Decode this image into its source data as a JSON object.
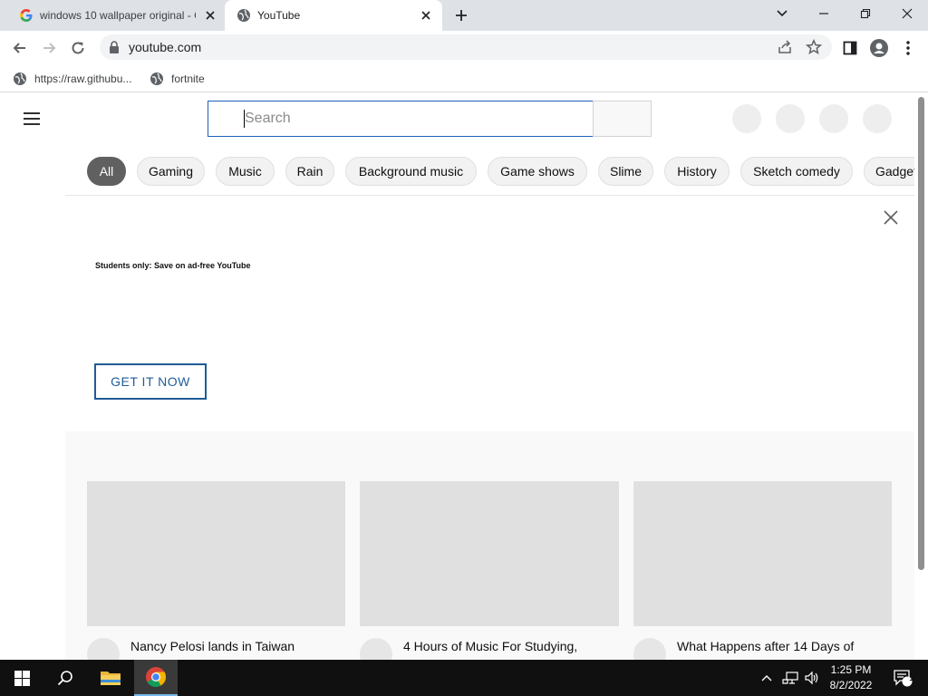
{
  "browser": {
    "tabs": [
      {
        "title": "windows 10 wallpaper original - G",
        "active": false
      },
      {
        "title": "YouTube",
        "active": true
      }
    ],
    "address": "youtube.com",
    "bookmarks": [
      {
        "label": "https://raw.githubu..."
      },
      {
        "label": "fortnite"
      }
    ]
  },
  "youtube": {
    "search_placeholder": "Search",
    "chips": [
      "All",
      "Gaming",
      "Music",
      "Rain",
      "Background music",
      "Game shows",
      "Slime",
      "History",
      "Sketch comedy",
      "Gadgets"
    ],
    "ad": {
      "heading": "Students only: Save on ad-free YouTube",
      "cta": "GET IT NOW"
    },
    "videos": [
      {
        "title": "Nancy Pelosi lands in Taiwan"
      },
      {
        "title": "4 Hours of Music For Studying,"
      },
      {
        "title": "What Happens after 14 Days of"
      }
    ]
  },
  "taskbar": {
    "time": "1:25 PM",
    "date": "8/2/2022",
    "notifications": "1"
  },
  "colors": {
    "tabstrip": "#dee1e6",
    "search_border": "#1c62b9",
    "cta": "#1f5b97",
    "taskbar": "#101010"
  }
}
